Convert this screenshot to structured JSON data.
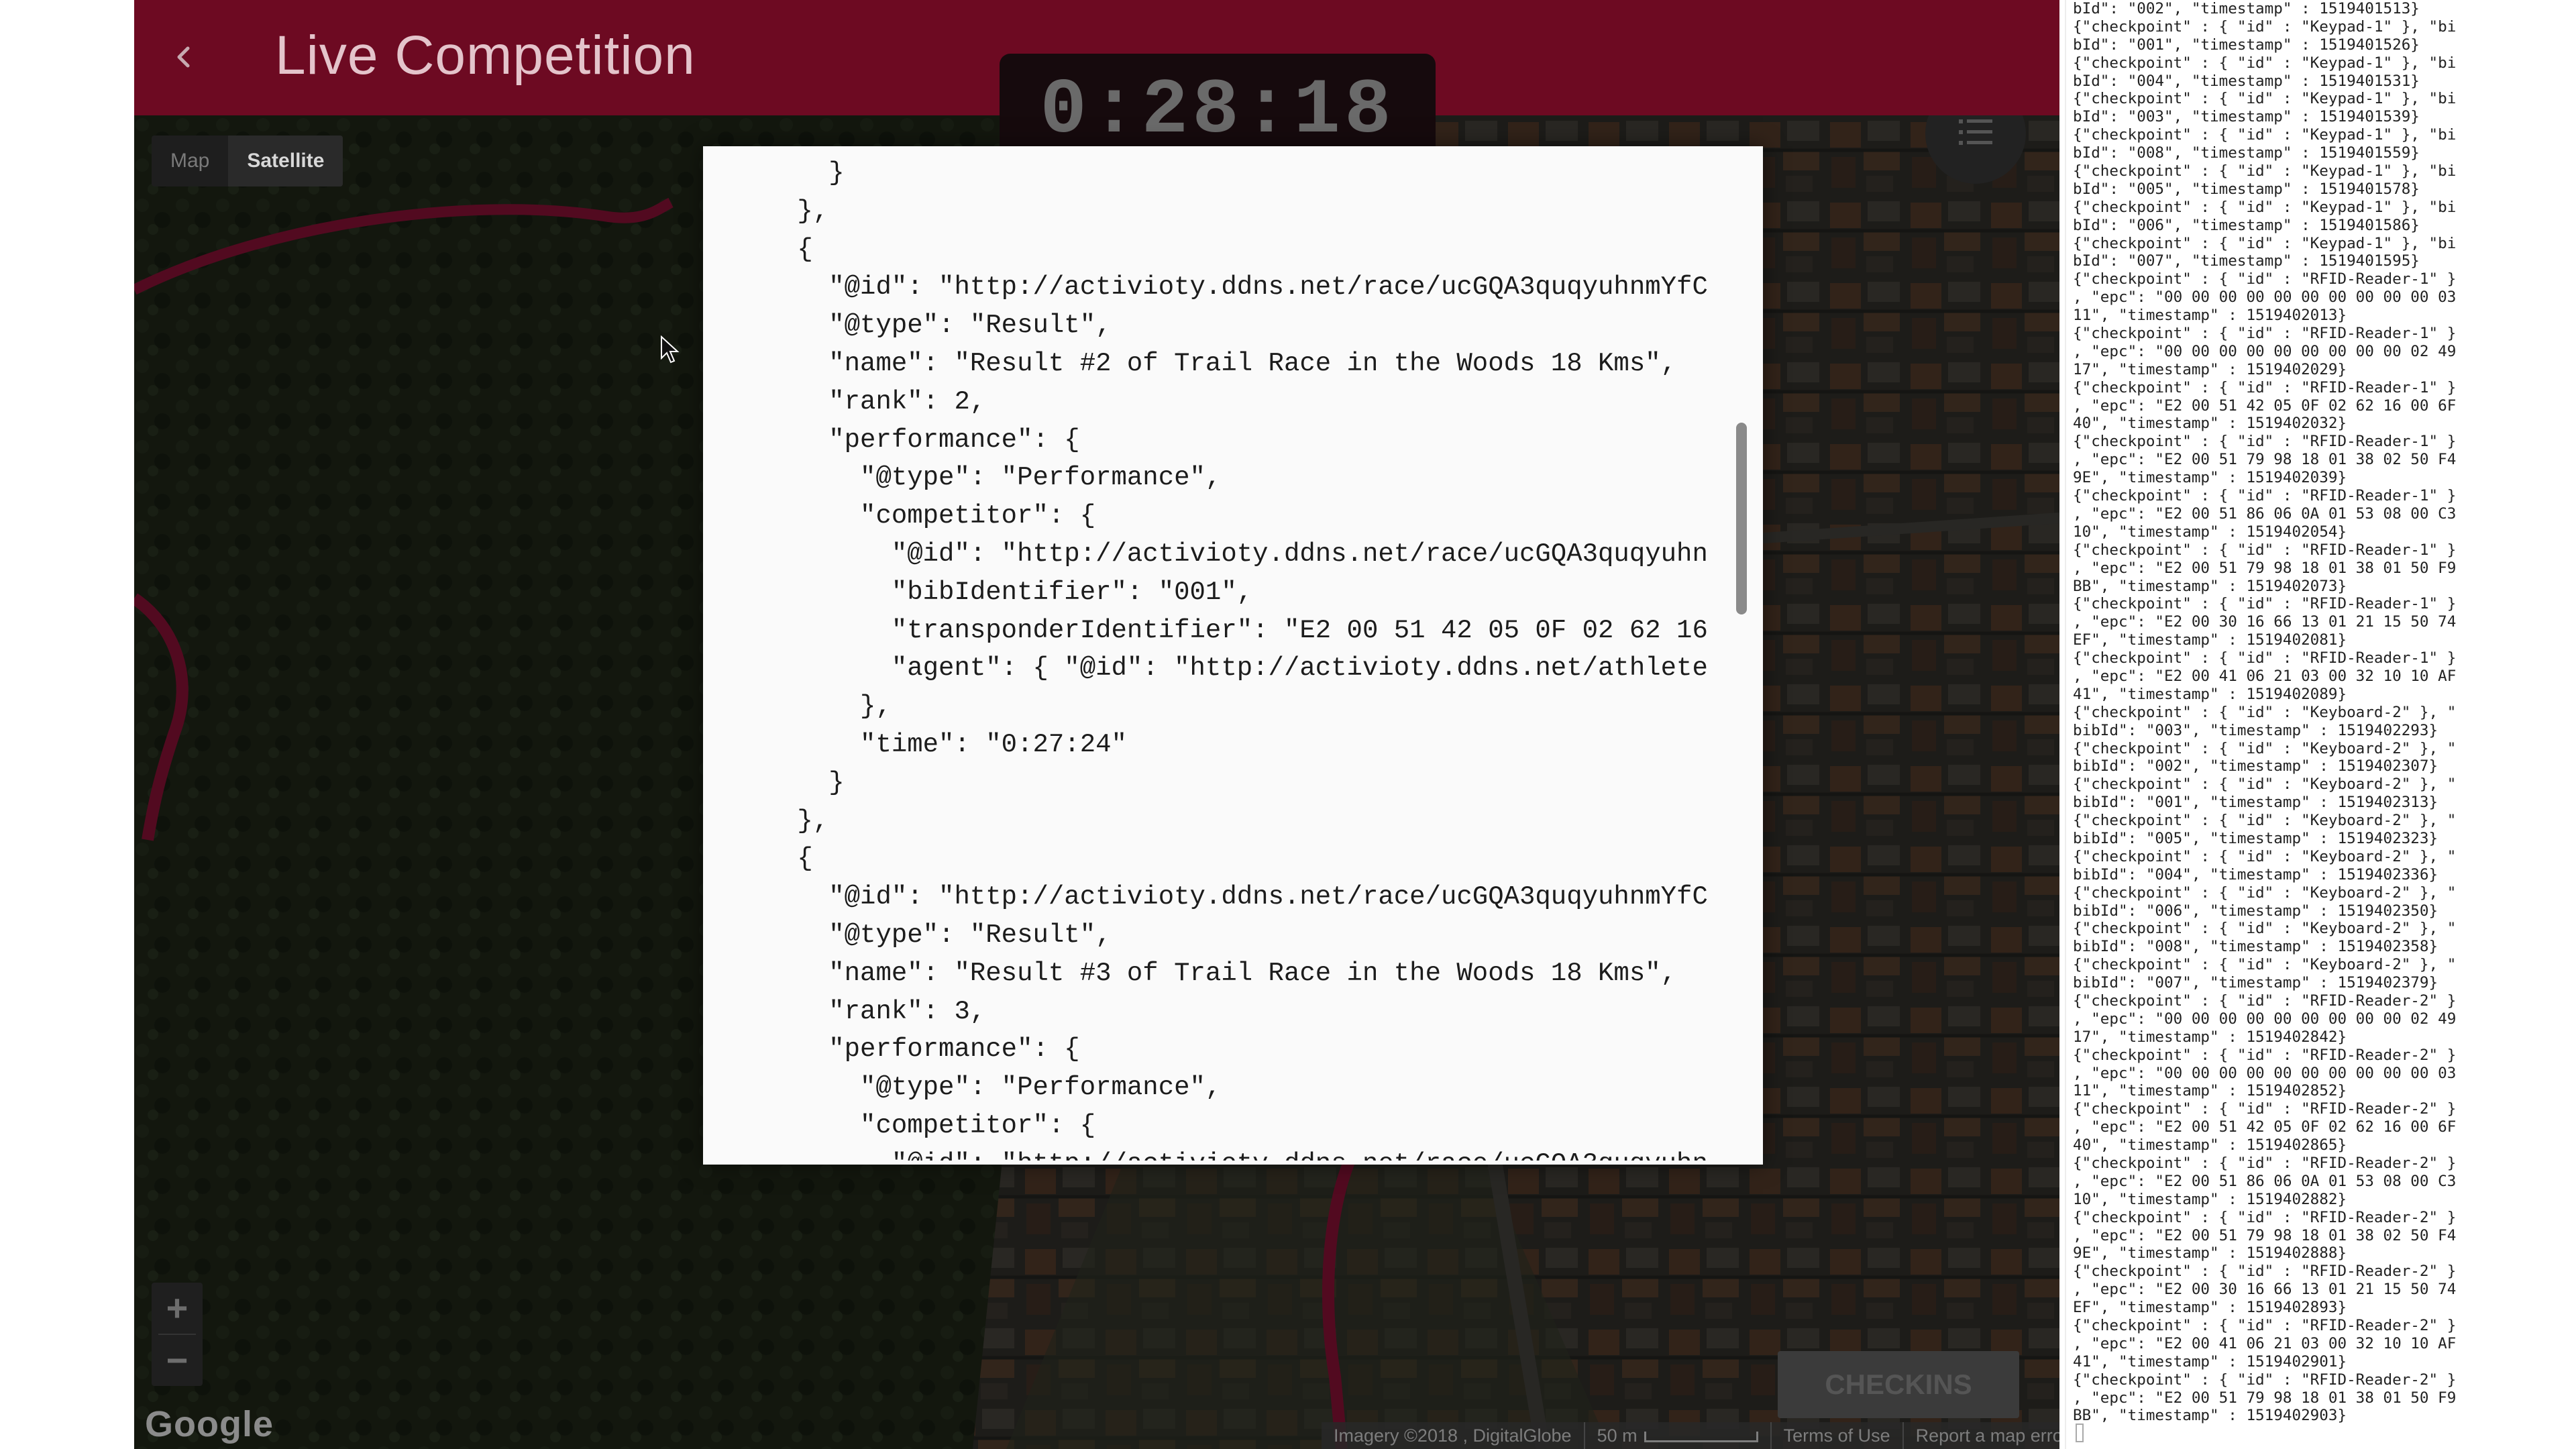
{
  "header": {
    "title": "Live Competition",
    "timer": "0:28:18"
  },
  "map": {
    "type_options": [
      {
        "label": "Map",
        "active": false
      },
      {
        "label": "Satellite",
        "active": true
      }
    ],
    "zoom_in": "+",
    "zoom_out": "−",
    "logo": "Google",
    "footer": {
      "imagery": "Imagery ©2018 , DigitalGlobe",
      "scale": "50 m",
      "terms": "Terms of Use",
      "report": "Report a map error"
    },
    "checkins_label": "CHECKINS",
    "route_color": "#7a1030"
  },
  "json_dialog": {
    "lines": [
      "        }",
      "      },",
      "      {",
      "        \"@id\": \"http://activioty.ddns.net/race/ucGQA3quqyuhnmYfC",
      "        \"@type\": \"Result\",",
      "        \"name\": \"Result #2 of Trail Race in the Woods 18 Kms\",",
      "        \"rank\": 2,",
      "        \"performance\": {",
      "          \"@type\": \"Performance\",",
      "          \"competitor\": {",
      "            \"@id\": \"http://activioty.ddns.net/race/ucGQA3quqyuhn",
      "            \"bibIdentifier\": \"001\",",
      "            \"transponderIdentifier\": \"E2 00 51 42 05 0F 02 62 16",
      "            \"agent\": { \"@id\": \"http://activioty.ddns.net/athlete",
      "          },",
      "          \"time\": \"0:27:24\"",
      "        }",
      "      },",
      "      {",
      "        \"@id\": \"http://activioty.ddns.net/race/ucGQA3quqyuhnmYfC",
      "        \"@type\": \"Result\",",
      "        \"name\": \"Result #3 of Trail Race in the Woods 18 Kms\",",
      "        \"rank\": 3,",
      "        \"performance\": {",
      "          \"@type\": \"Performance\",",
      "          \"competitor\": {",
      "            \"@id\": \"http://activioty.ddns.net/race/ucGQA3quqyuhn"
    ]
  },
  "log_panel": {
    "lines": [
      "bId\": \"002\", \"timestamp\" : 1519401513}",
      "{\"checkpoint\" : { \"id\" : \"Keypad-1\" }, \"bi",
      "bId\": \"001\", \"timestamp\" : 1519401526}",
      "{\"checkpoint\" : { \"id\" : \"Keypad-1\" }, \"bi",
      "bId\": \"004\", \"timestamp\" : 1519401531}",
      "{\"checkpoint\" : { \"id\" : \"Keypad-1\" }, \"bi",
      "bId\": \"003\", \"timestamp\" : 1519401539}",
      "{\"checkpoint\" : { \"id\" : \"Keypad-1\" }, \"bi",
      "bId\": \"008\", \"timestamp\" : 1519401559}",
      "{\"checkpoint\" : { \"id\" : \"Keypad-1\" }, \"bi",
      "bId\": \"005\", \"timestamp\" : 1519401578}",
      "{\"checkpoint\" : { \"id\" : \"Keypad-1\" }, \"bi",
      "bId\": \"006\", \"timestamp\" : 1519401586}",
      "{\"checkpoint\" : { \"id\" : \"Keypad-1\" }, \"bi",
      "bId\": \"007\", \"timestamp\" : 1519401595}",
      "{\"checkpoint\" : { \"id\" : \"RFID-Reader-1\" }",
      ", \"epc\": \"00 00 00 00 00 00 00 00 00 00 03",
      "11\", \"timestamp\" : 1519402013}",
      "{\"checkpoint\" : { \"id\" : \"RFID-Reader-1\" }",
      ", \"epc\": \"00 00 00 00 00 00 00 00 00 02 49",
      "17\", \"timestamp\" : 1519402029}",
      "{\"checkpoint\" : { \"id\" : \"RFID-Reader-1\" }",
      ", \"epc\": \"E2 00 51 42 05 0F 02 62 16 00 6F",
      "40\", \"timestamp\" : 1519402032}",
      "{\"checkpoint\" : { \"id\" : \"RFID-Reader-1\" }",
      ", \"epc\": \"E2 00 51 79 98 18 01 38 02 50 F4",
      "9E\", \"timestamp\" : 1519402039}",
      "{\"checkpoint\" : { \"id\" : \"RFID-Reader-1\" }",
      ", \"epc\": \"E2 00 51 86 06 0A 01 53 08 00 C3",
      "10\", \"timestamp\" : 1519402054}",
      "{\"checkpoint\" : { \"id\" : \"RFID-Reader-1\" }",
      ", \"epc\": \"E2 00 51 79 98 18 01 38 01 50 F9",
      "BB\", \"timestamp\" : 1519402073}",
      "{\"checkpoint\" : { \"id\" : \"RFID-Reader-1\" }",
      ", \"epc\": \"E2 00 30 16 66 13 01 21 15 50 74",
      "EF\", \"timestamp\" : 1519402081}",
      "{\"checkpoint\" : { \"id\" : \"RFID-Reader-1\" }",
      ", \"epc\": \"E2 00 41 06 21 03 00 32 10 10 AF",
      "41\", \"timestamp\" : 1519402089}",
      "{\"checkpoint\" : { \"id\" : \"Keyboard-2\" }, \"",
      "bibId\": \"003\", \"timestamp\" : 1519402293}",
      "{\"checkpoint\" : { \"id\" : \"Keyboard-2\" }, \"",
      "bibId\": \"002\", \"timestamp\" : 1519402307}",
      "{\"checkpoint\" : { \"id\" : \"Keyboard-2\" }, \"",
      "bibId\": \"001\", \"timestamp\" : 1519402313}",
      "{\"checkpoint\" : { \"id\" : \"Keyboard-2\" }, \"",
      "bibId\": \"005\", \"timestamp\" : 1519402323}",
      "{\"checkpoint\" : { \"id\" : \"Keyboard-2\" }, \"",
      "bibId\": \"004\", \"timestamp\" : 1519402336}",
      "{\"checkpoint\" : { \"id\" : \"Keyboard-2\" }, \"",
      "bibId\": \"006\", \"timestamp\" : 1519402350}",
      "{\"checkpoint\" : { \"id\" : \"Keyboard-2\" }, \"",
      "bibId\": \"008\", \"timestamp\" : 1519402358}",
      "{\"checkpoint\" : { \"id\" : \"Keyboard-2\" }, \"",
      "bibId\": \"007\", \"timestamp\" : 1519402379}",
      "{\"checkpoint\" : { \"id\" : \"RFID-Reader-2\" }",
      ", \"epc\": \"00 00 00 00 00 00 00 00 00 02 49",
      "17\", \"timestamp\" : 1519402842}",
      "{\"checkpoint\" : { \"id\" : \"RFID-Reader-2\" }",
      ", \"epc\": \"00 00 00 00 00 00 00 00 00 00 03",
      "11\", \"timestamp\" : 1519402852}",
      "{\"checkpoint\" : { \"id\" : \"RFID-Reader-2\" }",
      ", \"epc\": \"E2 00 51 42 05 0F 02 62 16 00 6F",
      "40\", \"timestamp\" : 1519402865}",
      "{\"checkpoint\" : { \"id\" : \"RFID-Reader-2\" }",
      ", \"epc\": \"E2 00 51 86 06 0A 01 53 08 00 C3",
      "10\", \"timestamp\" : 1519402882}",
      "{\"checkpoint\" : { \"id\" : \"RFID-Reader-2\" }",
      ", \"epc\": \"E2 00 51 79 98 18 01 38 02 50 F4",
      "9E\", \"timestamp\" : 1519402888}",
      "{\"checkpoint\" : { \"id\" : \"RFID-Reader-2\" }",
      ", \"epc\": \"E2 00 30 16 66 13 01 21 15 50 74",
      "EF\", \"timestamp\" : 1519402893}",
      "{\"checkpoint\" : { \"id\" : \"RFID-Reader-2\" }",
      ", \"epc\": \"E2 00 41 06 21 03 00 32 10 10 AF",
      "41\", \"timestamp\" : 1519402901}",
      "{\"checkpoint\" : { \"id\" : \"RFID-Reader-2\" }",
      ", \"epc\": \"E2 00 51 79 98 18 01 38 01 50 F9",
      "BB\", \"timestamp\" : 1519402903}"
    ]
  },
  "colors": {
    "header_bg": "#6d0a22",
    "title_text": "#e4c4cb",
    "timer_bg": "#160a0d"
  }
}
